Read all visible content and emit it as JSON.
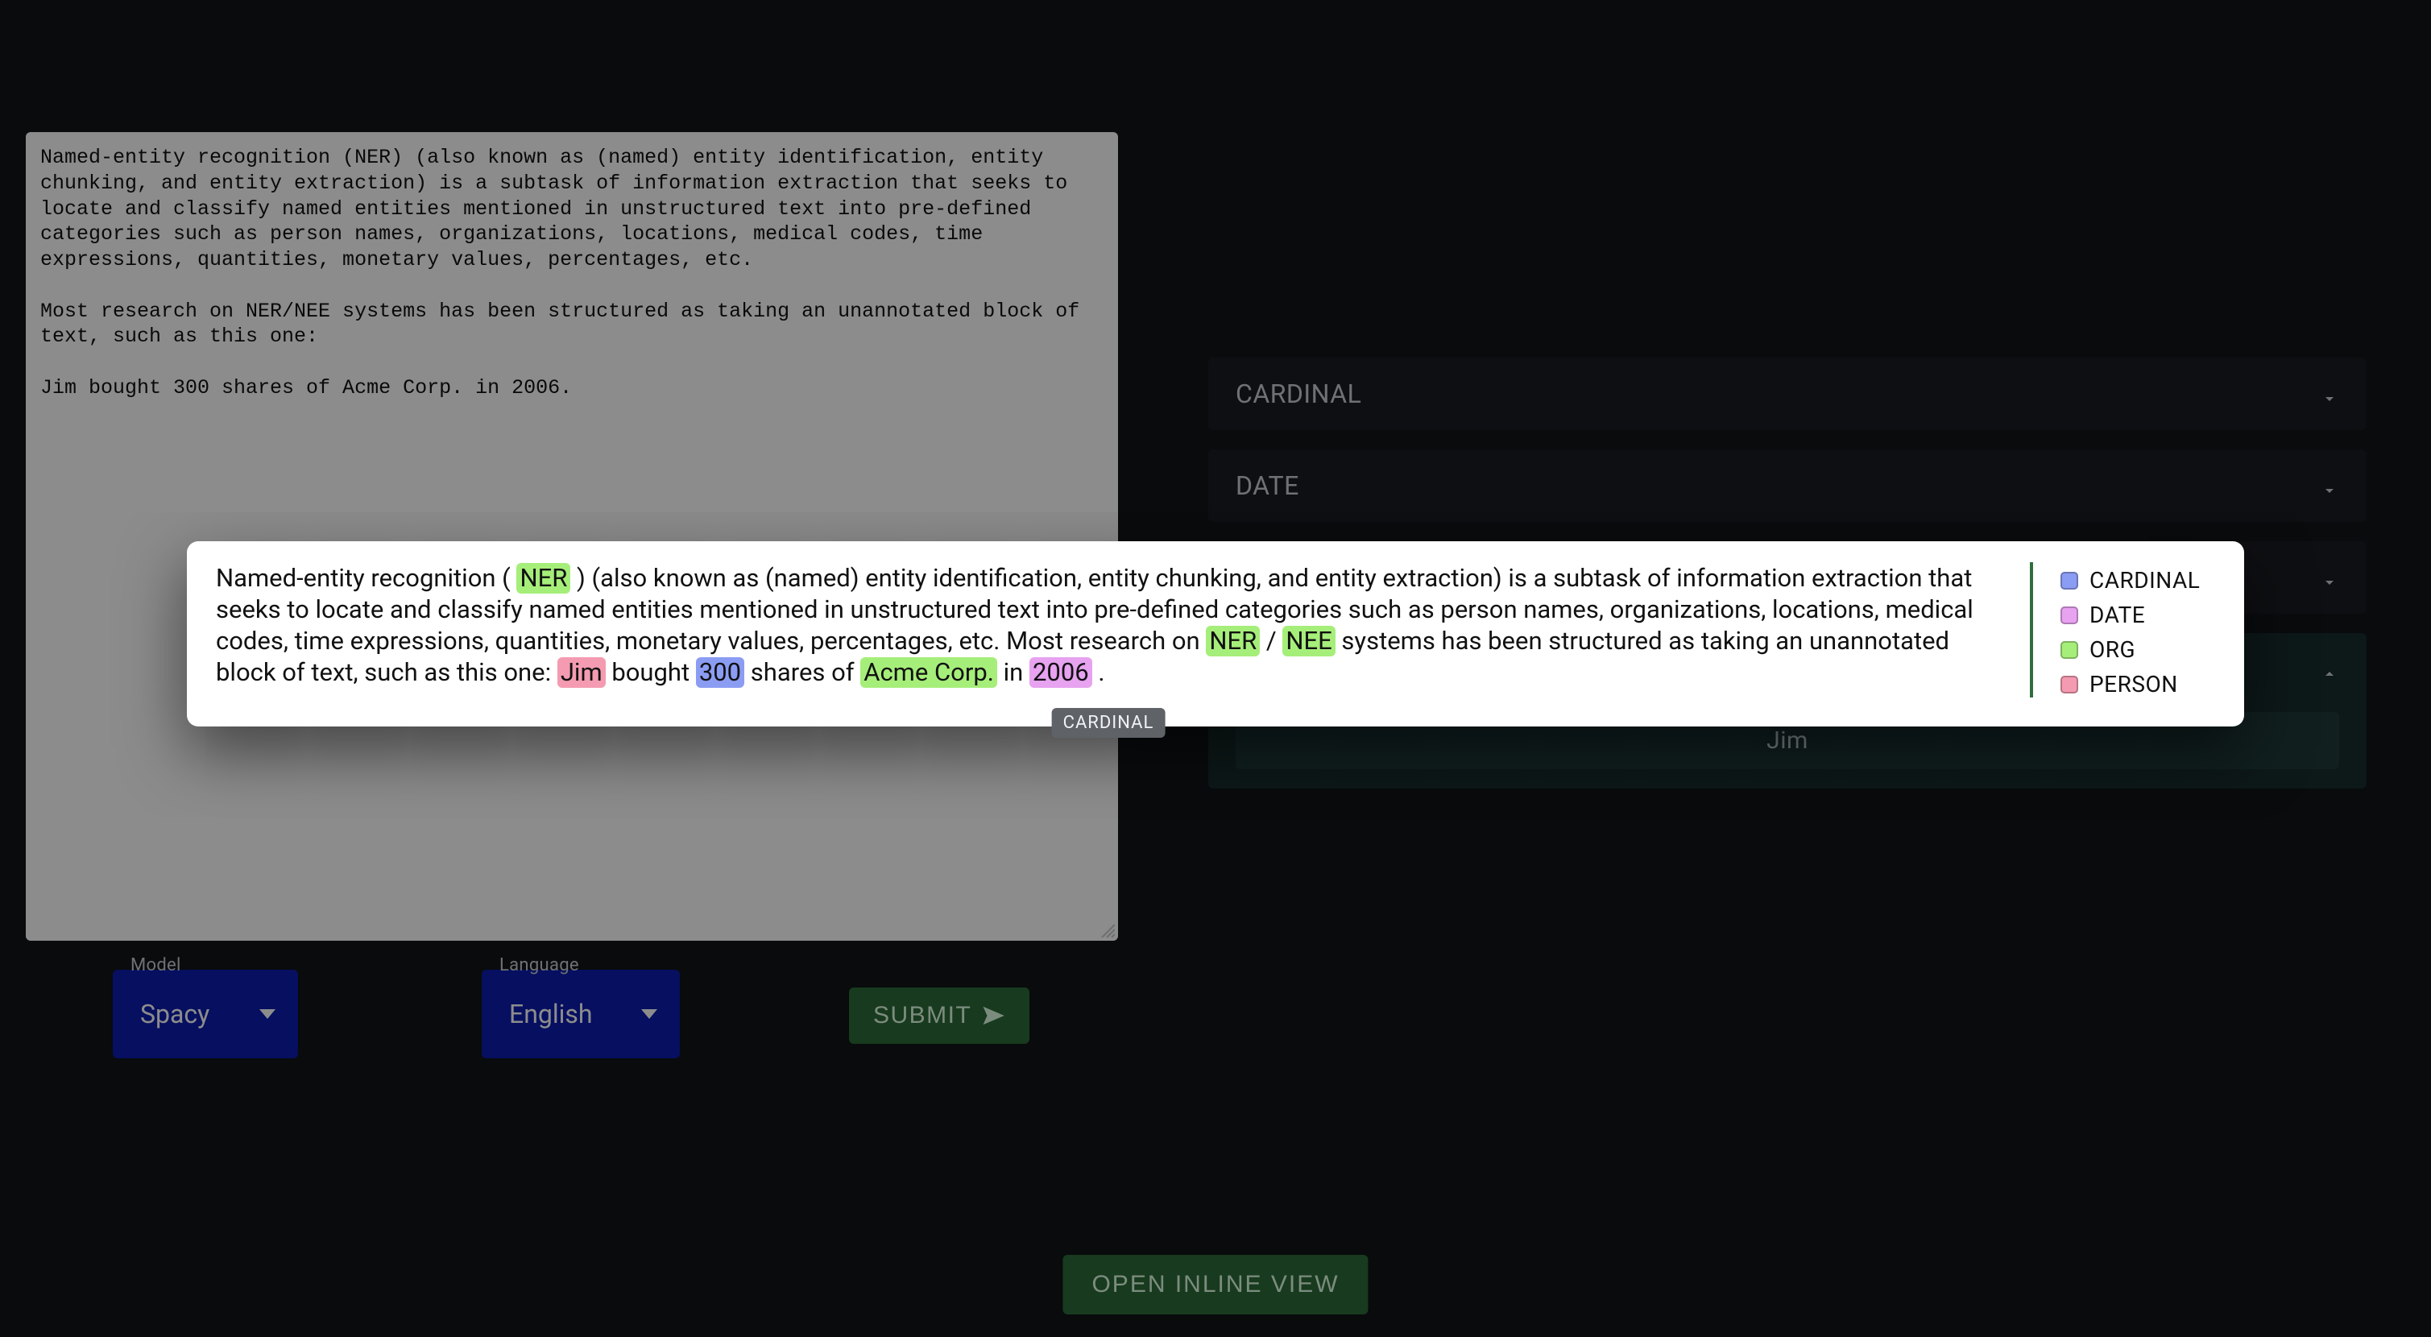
{
  "textarea_value": "Named-entity recognition (NER) (also known as (named) entity identification, entity chunking, and entity extraction) is a subtask of information extraction that seeks to locate and classify named entities mentioned in unstructured text into pre-defined categories such as person names, organizations, locations, medical codes, time expressions, quantities, monetary values, percentages, etc.\n\nMost research on NER/NEE systems has been structured as taking an unannotated block of text, such as this one:\n\nJim bought 300 shares of Acme Corp. in 2006.",
  "selects": {
    "model": {
      "label": "Model",
      "value": "Spacy"
    },
    "language": {
      "label": "Language",
      "value": "English"
    }
  },
  "submit_label": "SUBMIT",
  "open_inline_label": "OPEN INLINE VIEW",
  "entity_groups": [
    {
      "name": "CARDINAL",
      "expanded": false,
      "items": []
    },
    {
      "name": "DATE",
      "expanded": false,
      "items": []
    },
    {
      "name": "ORG",
      "expanded": false,
      "items": []
    },
    {
      "name": "PERSON",
      "expanded": true,
      "items": [
        "Jim"
      ]
    }
  ],
  "inline_view": {
    "tooltip": "CARDINAL",
    "legend": [
      {
        "label": "CARDINAL",
        "swatch": "sw-cardinal"
      },
      {
        "label": "DATE",
        "swatch": "sw-date"
      },
      {
        "label": "ORG",
        "swatch": "sw-org"
      },
      {
        "label": "PERSON",
        "swatch": "sw-person"
      }
    ],
    "tokens": [
      {
        "t": "Named-entity recognition ( "
      },
      {
        "t": "NER",
        "cls": "hl hl-org"
      },
      {
        "t": " ) (also known as (named) entity identification, entity chunking, and entity extraction) is a subtask of information extraction that seeks to locate and classify named entities mentioned in unstructured text into pre-defined categories such as person names, organizations, locations, medical codes, time expressions, quantities, monetary values, percentages, etc. Most research on "
      },
      {
        "t": "NER",
        "cls": "hl hl-org"
      },
      {
        "t": " / "
      },
      {
        "t": "NEE",
        "cls": "hl hl-org"
      },
      {
        "t": " systems has been structured as taking an unannotated block of text, such as this one: "
      },
      {
        "t": "Jim",
        "cls": "hl hl-person"
      },
      {
        "t": " bought "
      },
      {
        "t": "300",
        "cls": "hl hl-cardinal"
      },
      {
        "t": " shares of "
      },
      {
        "t": "Acme Corp.",
        "cls": "hl hl-org"
      },
      {
        "t": " in "
      },
      {
        "t": "2006",
        "cls": "hl hl-date"
      },
      {
        "t": " ."
      }
    ]
  },
  "colors": {
    "bg": "#121418",
    "panel": "#1a1d22",
    "panel_expanded": "#182c2c",
    "primary_blue": "#0b1db0",
    "primary_green": "#2d6b38",
    "cardinal": "#8b9cf3",
    "date": "#e7a2f0",
    "org": "#a6ee7a",
    "person": "#f49bb1"
  }
}
